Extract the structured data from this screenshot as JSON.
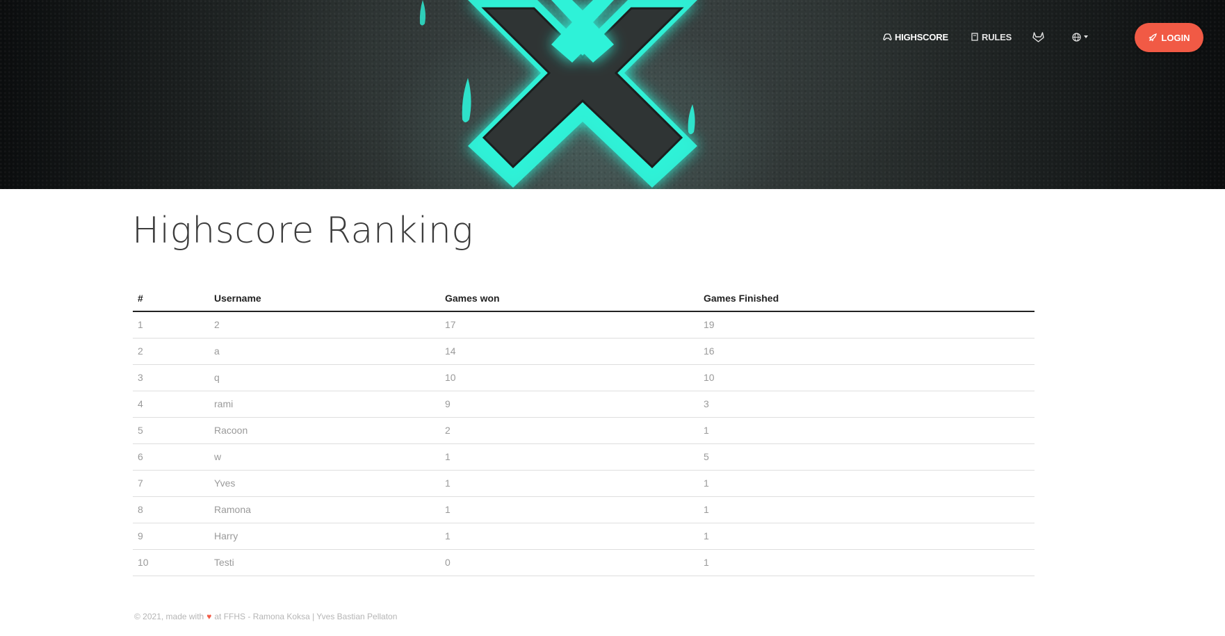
{
  "nav": {
    "items": [
      {
        "label": "HIGHSCORE",
        "icon": "gamepad-icon"
      },
      {
        "label": "RULES",
        "icon": "book-icon"
      }
    ],
    "gitlab_icon": "gitlab-icon",
    "language_icon": "globe-icon",
    "login_label": "LOGIN",
    "login_icon": "rocket-icon",
    "accent_color": "#f15a45"
  },
  "main": {
    "title": "Highscore Ranking",
    "table": {
      "headers": [
        "#",
        "Username",
        "Games won",
        "Games Finished"
      ],
      "rows": [
        [
          "1",
          "2",
          "17",
          "19"
        ],
        [
          "2",
          "a",
          "14",
          "16"
        ],
        [
          "3",
          "q",
          "10",
          "10"
        ],
        [
          "4",
          "rami",
          "9",
          "3"
        ],
        [
          "5",
          "Racoon",
          "2",
          "1"
        ],
        [
          "6",
          "w",
          "1",
          "5"
        ],
        [
          "7",
          "Yves",
          "1",
          "1"
        ],
        [
          "8",
          "Ramona",
          "1",
          "1"
        ],
        [
          "9",
          "Harry",
          "1",
          "1"
        ],
        [
          "10",
          "Testi",
          "0",
          "1"
        ]
      ]
    }
  },
  "footer": {
    "prefix": "© 2021, made with",
    "suffix": "at FFHS - Ramona Koksa | Yves Bastian Pellaton",
    "heart_color": "#f15a45"
  },
  "hero": {
    "logo_color": "#2ef2d8"
  }
}
